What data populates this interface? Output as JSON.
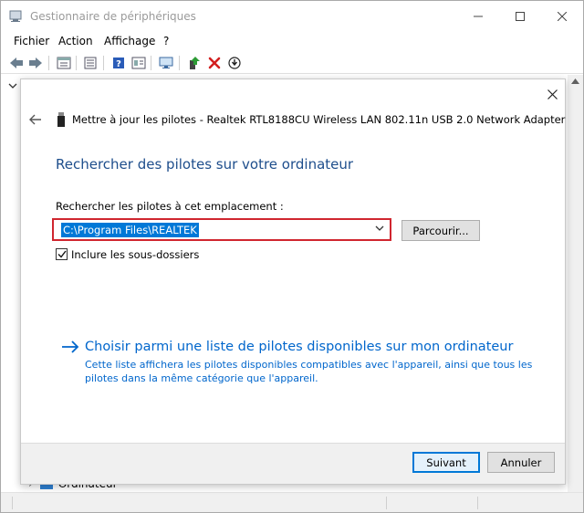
{
  "window": {
    "title": "Gestionnaire de périphériques"
  },
  "menu": {
    "items": [
      "Fichier",
      "Action",
      "Affichage",
      "?"
    ]
  },
  "toolbar": {
    "icons": [
      "back-arrow-icon",
      "forward-arrow-icon",
      "properties-icon",
      "list-icon",
      "help-icon",
      "view-icon",
      "monitor-icon",
      "update-driver-icon",
      "uninstall-icon",
      "download-icon"
    ]
  },
  "tree": {
    "partial_item": "Ordinateur"
  },
  "dialog": {
    "header": "Mettre à jour les pilotes - Realtek RTL8188CU Wireless LAN 802.11n USB 2.0 Network Adapter",
    "heading": "Rechercher des pilotes sur votre ordinateur",
    "search_label": "Rechercher les pilotes à cet emplacement :",
    "path_value": "C:\\Program Files\\REALTEK",
    "browse_label": "Parcourir...",
    "include_subfolders_label": "Inclure les sous-dossiers",
    "include_subfolders_checked": true,
    "pick_link": "Choisir parmi une liste de pilotes disponibles sur mon ordinateur",
    "pick_desc": "Cette liste affichera les pilotes disponibles compatibles avec l'appareil, ainsi que tous les pilotes dans la même catégorie que l'appareil.",
    "next_label": "Suivant",
    "cancel_label": "Annuler"
  },
  "colors": {
    "heading": "#1e4e8c",
    "link": "#0066cc",
    "highlight_border": "#d0262f",
    "selection": "#0078d7"
  }
}
